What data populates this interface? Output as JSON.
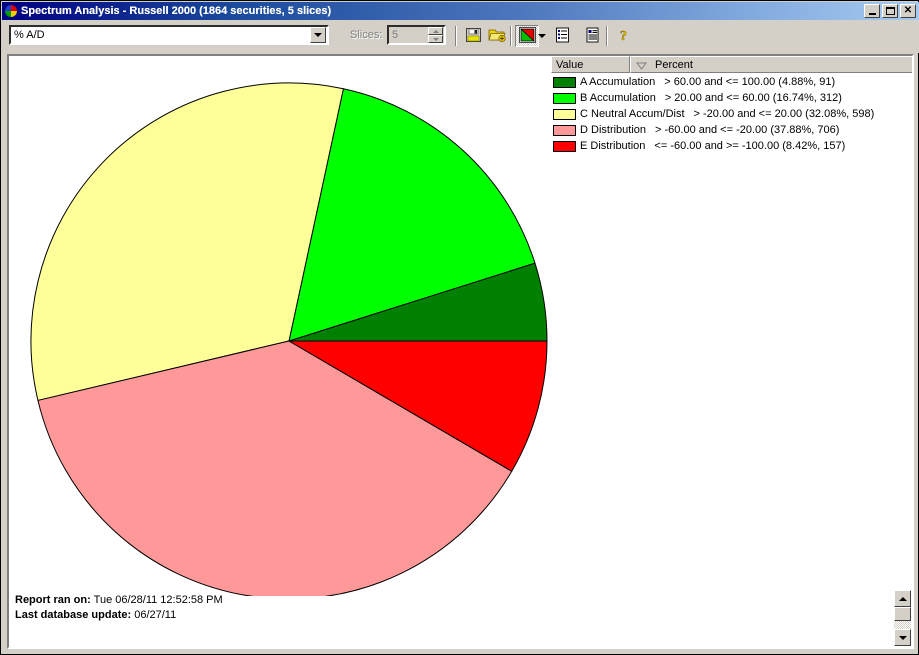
{
  "window": {
    "title": "Spectrum Analysis - Russell 2000 (1864 securities, 5 slices)",
    "icon": "pie-chart-icon",
    "minimize_label": "",
    "maximize_label": "",
    "close_label": "✕"
  },
  "toolbar": {
    "indicator_select": {
      "value": "% A/D",
      "icon": "chevron-down-icon"
    },
    "slices_label": "Slices:",
    "slices_value": "5",
    "buttons": [
      {
        "name": "save-button",
        "icon": "floppy-disk-icon",
        "label": "Save"
      },
      {
        "name": "open-button",
        "icon": "open-folder-icon",
        "label": "Open"
      },
      {
        "name": "chart-type-button",
        "icon": "pie-chart-icon",
        "label": "Chart"
      },
      {
        "name": "chart-type-dropdown",
        "icon": "chevron-down-icon",
        "label": "Chart Type"
      },
      {
        "name": "list-view-button",
        "icon": "list-icon",
        "label": "List"
      },
      {
        "name": "report-view-button",
        "icon": "report-icon",
        "label": "Report"
      },
      {
        "name": "help-button",
        "icon": "question-mark-icon",
        "label": "Help"
      }
    ]
  },
  "legend": {
    "columns": [
      "Value",
      "Percent"
    ],
    "sorted_column": "Percent",
    "sort_icon": "sort-descending-icon",
    "rows": [
      {
        "color": "#008000",
        "name": "A Accumulation",
        "desc": "> 60.00 and <= 100.00 (4.88%, 91)"
      },
      {
        "color": "#00FF00",
        "name": "B Accumulation",
        "desc": "> 20.00 and <= 60.00 (16.74%, 312)"
      },
      {
        "color": "#FFFF99",
        "name": "C Neutral Accum/Dist",
        "desc": "> -20.00 and <= 20.00 (32.08%, 598)"
      },
      {
        "color": "#FF9999",
        "name": "D Distribution",
        "desc": "> -60.00 and <= -20.00 (37.88%, 706)"
      },
      {
        "color": "#FF0000",
        "name": "E Distribution",
        "desc": "<= -60.00 and >= -100.00 (8.42%, 157)"
      }
    ]
  },
  "footer": {
    "report_ran_label": "Report ran on:",
    "report_ran_value": "Tue 06/28/11 12:52:58 PM",
    "last_update_label": "Last database update:",
    "last_update_value": "06/27/11"
  },
  "scrollbar": {
    "up_icon": "triangle-up-icon",
    "down_icon": "triangle-down-icon",
    "thumb": "scroll-thumb"
  },
  "chart_data": {
    "type": "pie",
    "title": "Spectrum Analysis - Russell 2000",
    "total_securities": 1864,
    "slices": 5,
    "start_angle_deg": 0,
    "direction": "counterclockwise",
    "center": [
      280,
      338
    ],
    "radius": 258,
    "categories": [
      "A Accumulation",
      "B Accumulation",
      "C Neutral Accum/Dist",
      "D Distribution",
      "E Distribution"
    ],
    "values": [
      4.88,
      16.74,
      32.08,
      37.88,
      8.42
    ],
    "counts": [
      91,
      312,
      598,
      706,
      157
    ],
    "colors": [
      "#008000",
      "#00FF00",
      "#FFFF99",
      "#FF9999",
      "#FF0000"
    ],
    "ranges": [
      "> 60.00 and <= 100.00",
      "> 20.00 and <= 60.00",
      "> -20.00 and <= 20.00",
      "> -60.00 and <= -20.00",
      "<= -60.00 and >= -100.00"
    ],
    "xlabel": "",
    "ylabel": "",
    "legend_position": "right",
    "grid": false
  }
}
